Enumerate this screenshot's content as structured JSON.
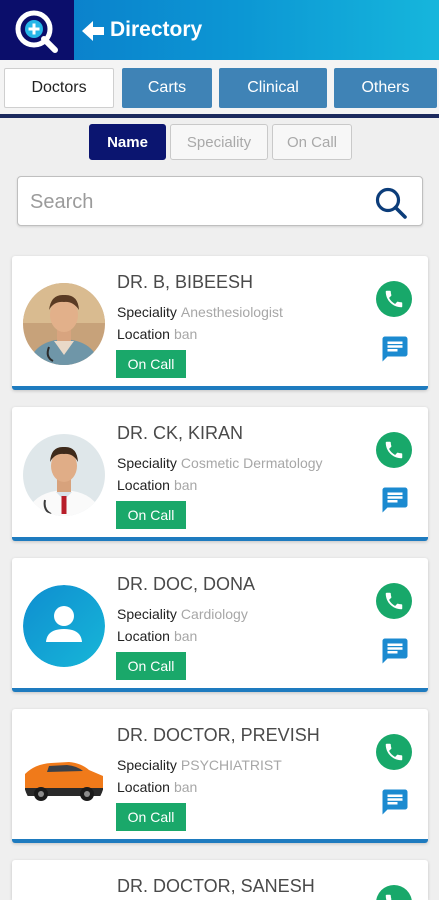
{
  "header": {
    "title": "Directory"
  },
  "tabs": [
    {
      "label": "Doctors",
      "active": true
    },
    {
      "label": "Carts",
      "active": false
    },
    {
      "label": "Clinical",
      "active": false
    },
    {
      "label": "Others",
      "active": false
    }
  ],
  "filters": [
    {
      "label": "Name",
      "active": true
    },
    {
      "label": "Speciality",
      "active": false
    },
    {
      "label": "On Call",
      "active": false
    }
  ],
  "search": {
    "placeholder": "Search",
    "value": ""
  },
  "labels": {
    "speciality": "Speciality",
    "location": "Location",
    "on_call": "On Call"
  },
  "doctors": [
    {
      "name": "DR. B, BIBEESH",
      "speciality": "Anesthesiologist",
      "location": "ban",
      "avatar": "doctor-photo"
    },
    {
      "name": "DR. CK, KIRAN",
      "speciality": "Cosmetic Dermatology",
      "location": "ban",
      "avatar": "doctor-photo"
    },
    {
      "name": "DR. DOC, DONA",
      "speciality": "Cardiology",
      "location": "ban",
      "avatar": "default-user-icon"
    },
    {
      "name": "DR. DOCTOR, PREVISH",
      "speciality": "PSYCHIATRIST",
      "location": "ban",
      "avatar": "car-photo"
    },
    {
      "name": "DR. DOCTOR, SANESH"
    }
  ],
  "colors": {
    "header_dark": "#0b0e6b",
    "header_gradient_start": "#0a79c9",
    "header_gradient_end": "#16b6dc",
    "tab_inactive": "#3f83b6",
    "chip_active": "#0b1570",
    "on_call_badge": "#1aa86a",
    "call_button": "#18a86a",
    "message_icon": "#1b8ad0",
    "card_accent": "#1e7bbf"
  }
}
